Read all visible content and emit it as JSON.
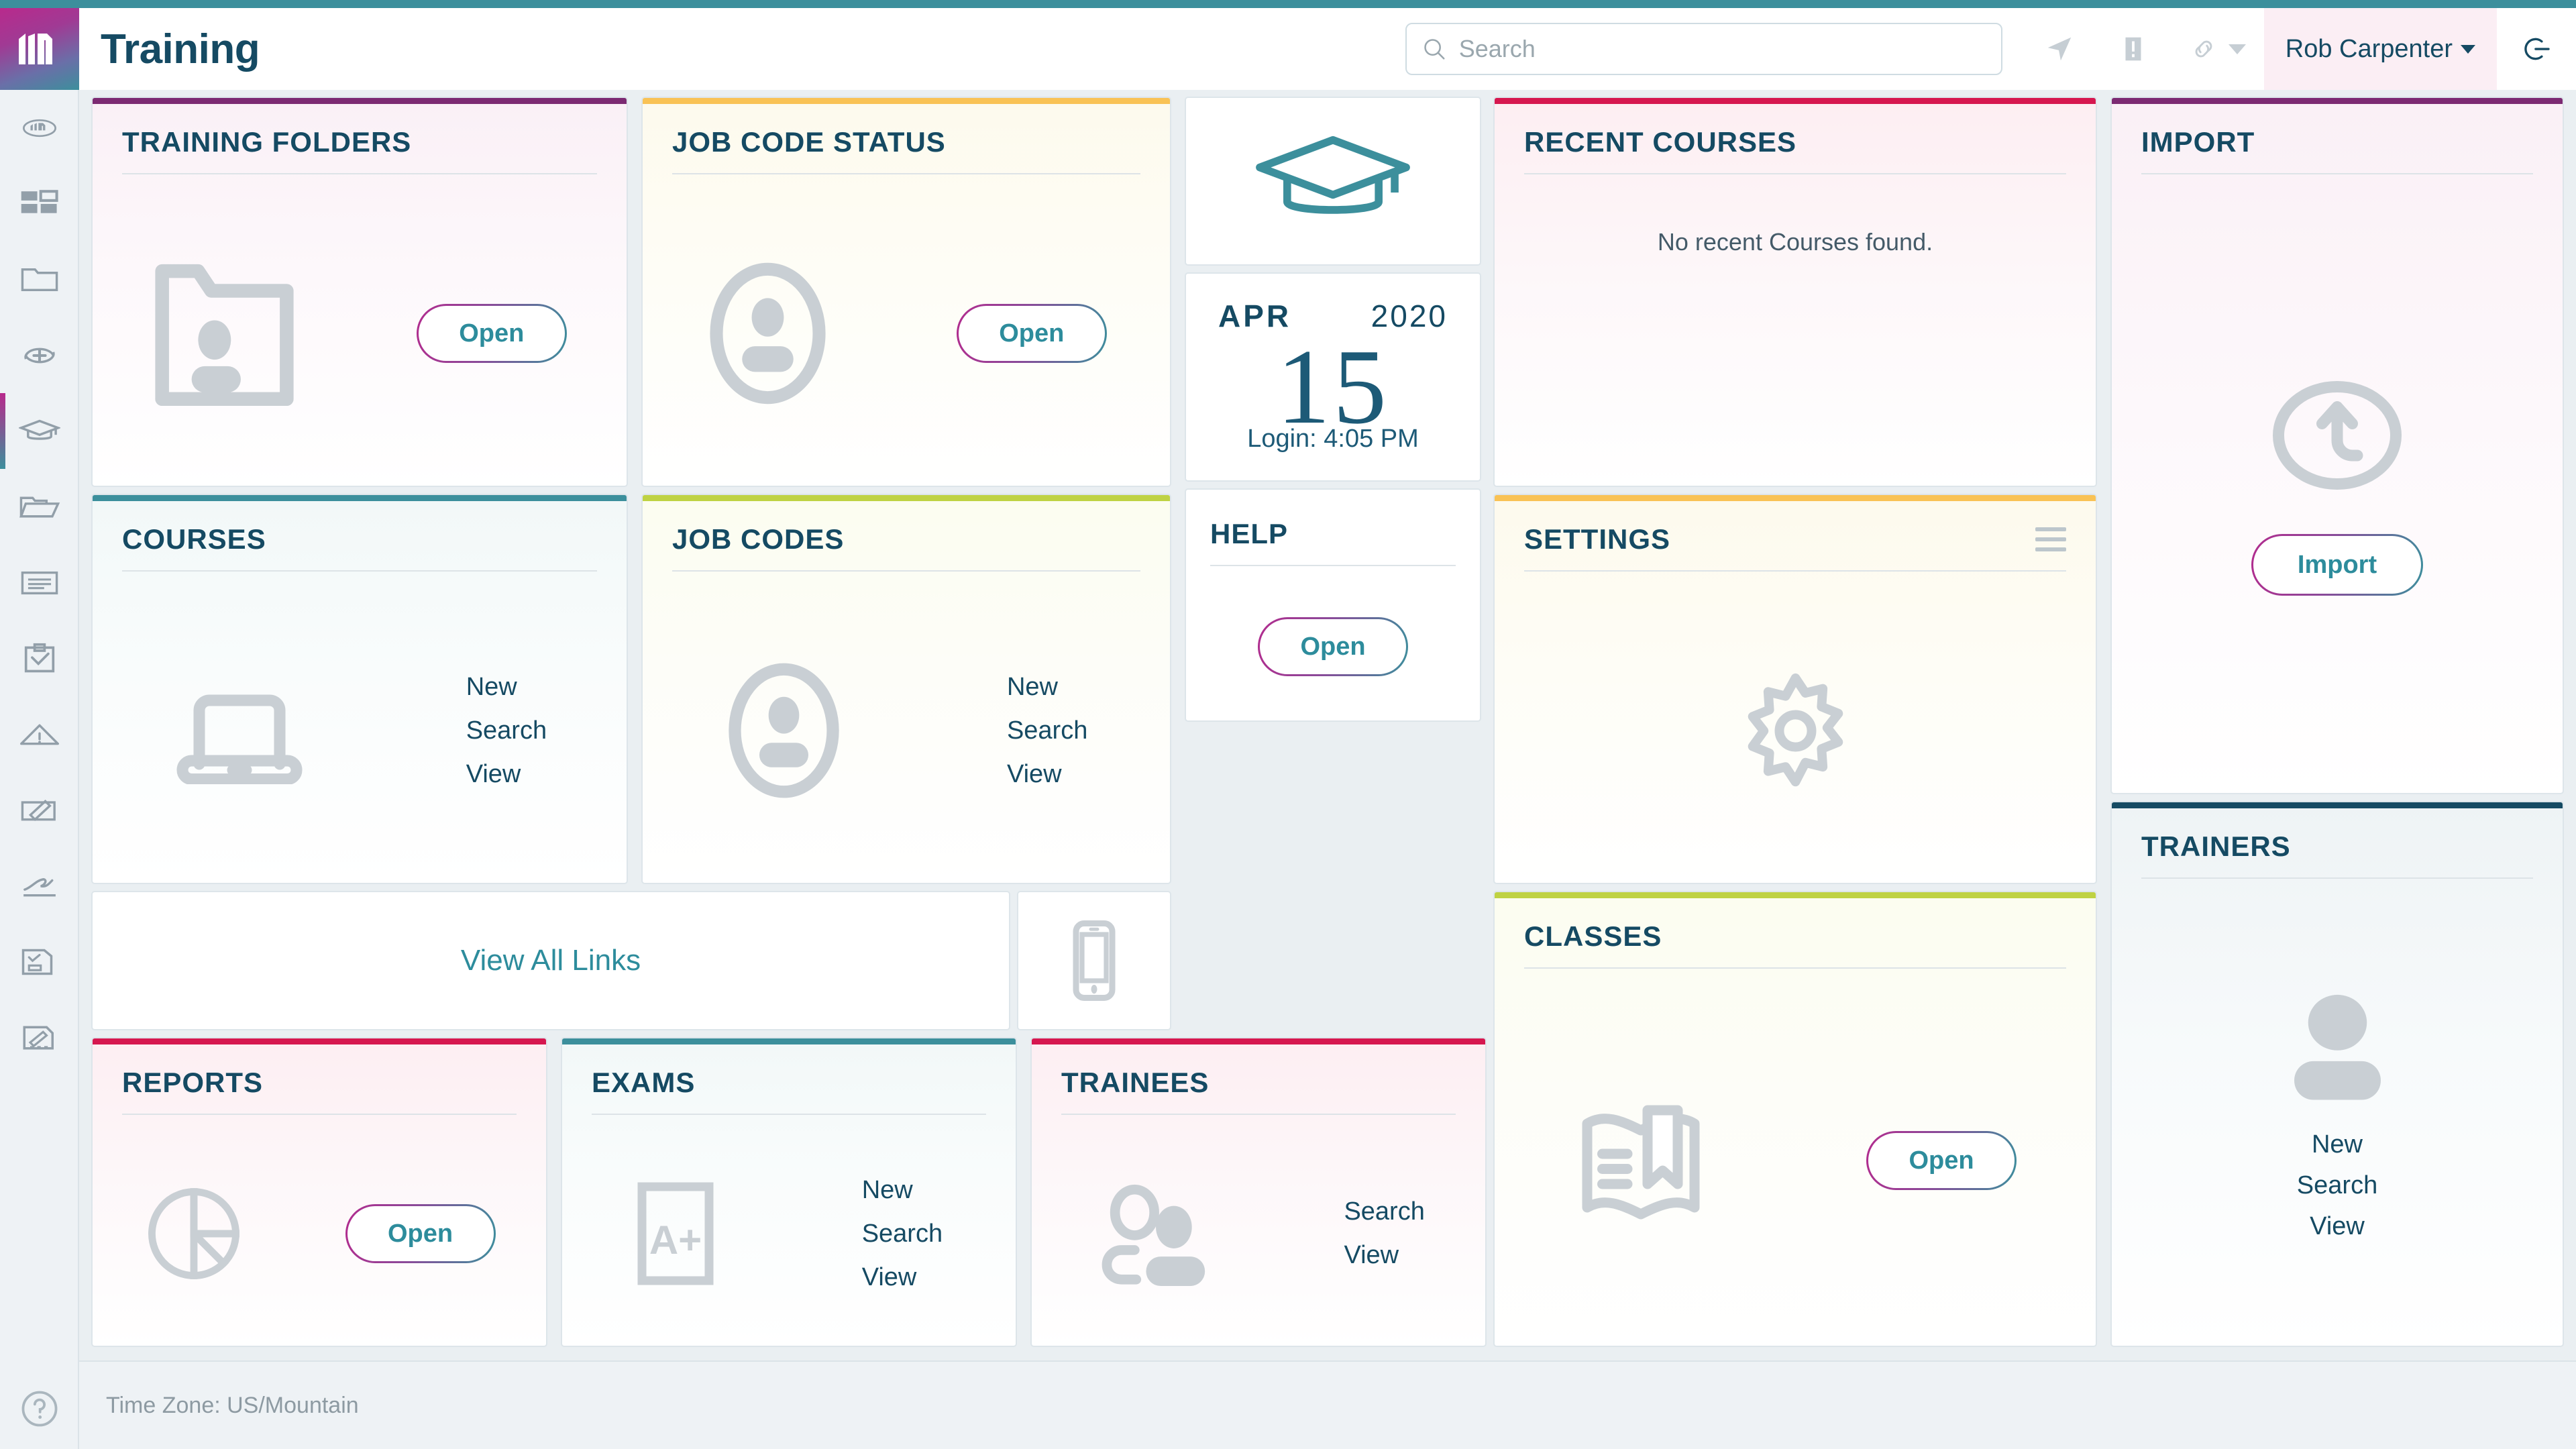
{
  "app": {
    "title": "Training",
    "logo_icon": "m-logo-icon",
    "accent_teal": "#3c8f9c",
    "accent_magenta": "#b82a8c",
    "title_color": "#154a63"
  },
  "header": {
    "search": {
      "placeholder": "Search",
      "value": "",
      "icon": "search-icon"
    },
    "icons": [
      {
        "name": "send-icon"
      },
      {
        "name": "alert-icon"
      },
      {
        "name": "link-icon",
        "has_caret": true
      }
    ],
    "user": {
      "name": "Rob Carpenter",
      "caret_icon": "chevron-down-icon"
    },
    "logout_icon": "power-icon"
  },
  "sidebar": {
    "items": [
      {
        "name": "home-oval-icon",
        "active": false
      },
      {
        "name": "dashboard-grid-icon",
        "active": false
      },
      {
        "name": "folder-icon",
        "active": false
      },
      {
        "name": "add-cycle-icon",
        "active": false
      },
      {
        "name": "graduation-cap-icon",
        "active": true
      },
      {
        "name": "file-folder-icon",
        "active": false
      },
      {
        "name": "document-lines-icon",
        "active": false
      },
      {
        "name": "clipboard-check-icon",
        "active": false
      },
      {
        "name": "warning-triangle-icon",
        "active": false
      },
      {
        "name": "edit-note-icon",
        "active": false
      },
      {
        "name": "signature-icon",
        "active": false
      },
      {
        "name": "form-check-icon",
        "active": false
      },
      {
        "name": "edit-document-icon",
        "active": false
      }
    ],
    "help_icon": "question-circle-icon"
  },
  "cards": {
    "training_folders": {
      "title": "TRAINING FOLDERS",
      "bar_color": "#7c2a72",
      "icon": "folder-person-icon",
      "button": "Open"
    },
    "job_code_status": {
      "title": "JOB CODE STATUS",
      "bar_color": "#f9c255",
      "icon": "person-circle-icon",
      "button": "Open"
    },
    "recent_courses": {
      "title": "RECENT COURSES",
      "bar_color": "#d6174f",
      "empty_message": "No recent Courses found."
    },
    "import": {
      "title": "IMPORT",
      "bar_color": "#7c2a72",
      "icon": "upload-circle-icon",
      "button": "Import"
    },
    "courses": {
      "title": "COURSES",
      "bar_color": "#3c8f9c",
      "icon": "laptop-icon",
      "links": [
        "New",
        "Search",
        "View"
      ]
    },
    "job_codes": {
      "title": "JOB CODES",
      "bar_color": "#bfd243",
      "icon": "person-circle-icon",
      "links": [
        "New",
        "Search",
        "View"
      ]
    },
    "settings": {
      "title": "SETTINGS",
      "bar_color": "#f9c255",
      "icon": "gear-icon",
      "menu_icon": "hamburger-icon"
    },
    "classes": {
      "title": "CLASSES",
      "bar_color": "#bfd243",
      "icon": "book-bookmark-icon",
      "button": "Open"
    },
    "trainers": {
      "title": "TRAINERS",
      "bar_color": "#154a63",
      "icon": "person-icon",
      "links": [
        "New",
        "Search",
        "View"
      ]
    },
    "help": {
      "title": "HELP",
      "button": "Open"
    },
    "reports": {
      "title": "REPORTS",
      "bar_color": "#d6174f",
      "icon": "pie-chart-icon",
      "button": "Open"
    },
    "exams": {
      "title": "EXAMS",
      "bar_color": "#3c8f9c",
      "icon": "grade-a-plus-icon",
      "links": [
        "New",
        "Search",
        "View"
      ]
    },
    "trainees": {
      "title": "TRAINEES",
      "bar_color": "#d6174f",
      "icon": "people-icon",
      "links": [
        "Search",
        "View"
      ]
    },
    "hero": {
      "icon": "graduation-cap-icon"
    },
    "mobile": {
      "icon": "mobile-phone-icon"
    },
    "view_all_links": {
      "label": "View All Links"
    }
  },
  "date_widget": {
    "month": "APR",
    "year": "2020",
    "day": "15",
    "login": "Login: 4:05 PM"
  },
  "footer": {
    "timezone": "Time Zone: US/Mountain"
  }
}
